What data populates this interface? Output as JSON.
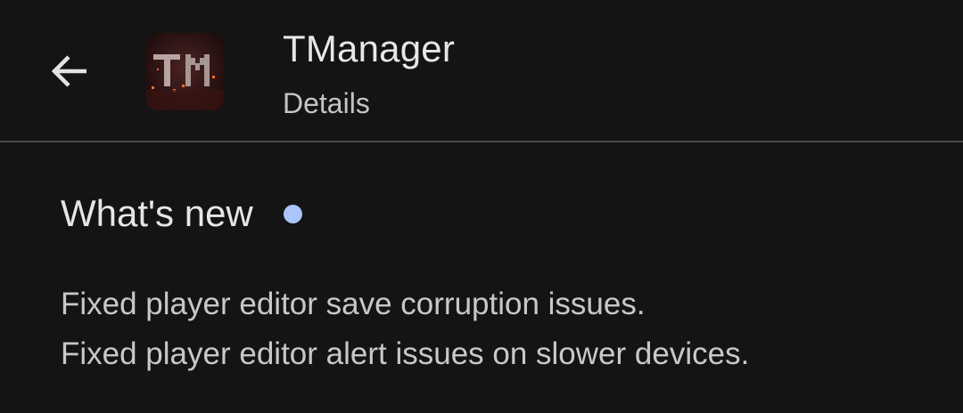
{
  "header": {
    "app_name": "TManager",
    "subtitle": "Details",
    "back_icon": "arrow-left-icon"
  },
  "whats_new": {
    "title": "What's new",
    "indicator_color": "#a9c5fb",
    "notes": [
      "Fixed player editor save corruption issues.",
      "Fixed player editor alert issues on slower devices."
    ]
  },
  "colors": {
    "background": "#141414",
    "divider": "#474747"
  }
}
